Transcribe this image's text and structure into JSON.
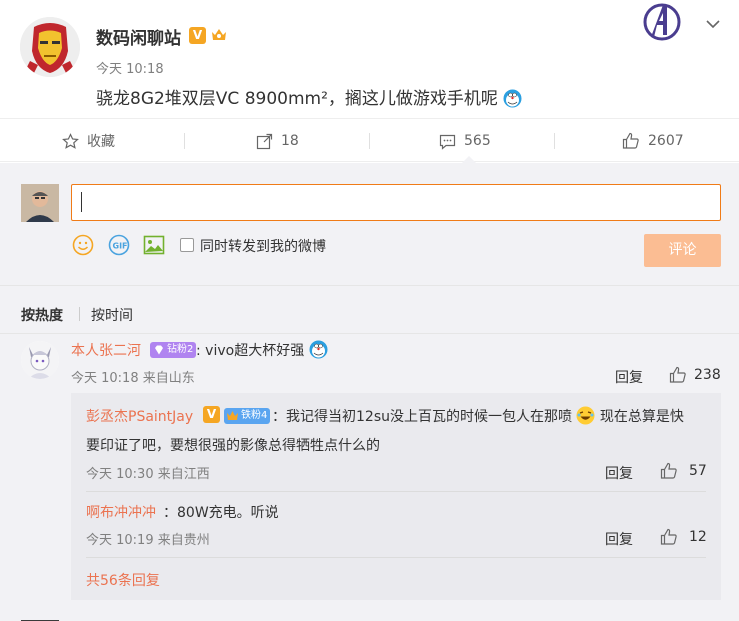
{
  "post": {
    "username": "数码闲聊站",
    "vip_mark": "V",
    "time": "今天 10:18",
    "text": "骁龙8G2堆双层VC 8900mm²，搁这儿做游戏手机呢"
  },
  "actions": {
    "favorite_label": "收藏",
    "forward_count": "18",
    "comment_count": "565",
    "like_count": "2607"
  },
  "composer": {
    "input_value": "",
    "forward_label": "同时转发到我的微博",
    "submit_label": "评论"
  },
  "sort": {
    "hot_label": "按热度",
    "time_label": "按时间"
  },
  "comments": [
    {
      "name": "本人张二河",
      "badge": "钻粉2",
      "text": ": vivo超大杯好强",
      "meta": "今天 10:18 来自山东",
      "reply_label": "回复",
      "likes": "238",
      "replies": [
        {
          "name": "彭丞杰PSaintJay",
          "badge": "铁粉4",
          "text_line1": "：我记得当初12su没上百瓦的时候一包人在那喷",
          "text_line1_tail": "现在总算是快",
          "text_line2": "要印证了吧，要想很强的影像总得牺牲点什么的",
          "meta": "今天 10:30 来自江西",
          "reply_label": "回复",
          "likes": "57"
        },
        {
          "name": "啊布冲冲冲",
          "text": "：80W充电。听说",
          "meta": "今天 10:19 来自贵州",
          "reply_label": "回复",
          "likes": "12"
        }
      ],
      "more_replies": "共56条回复"
    }
  ],
  "colors": {
    "accent": "#eb7350",
    "input_border": "#f07b17",
    "submit_bg": "#fbbd93",
    "comment_bg": "#f2f2f5",
    "reply_bg": "#eaeaee"
  }
}
